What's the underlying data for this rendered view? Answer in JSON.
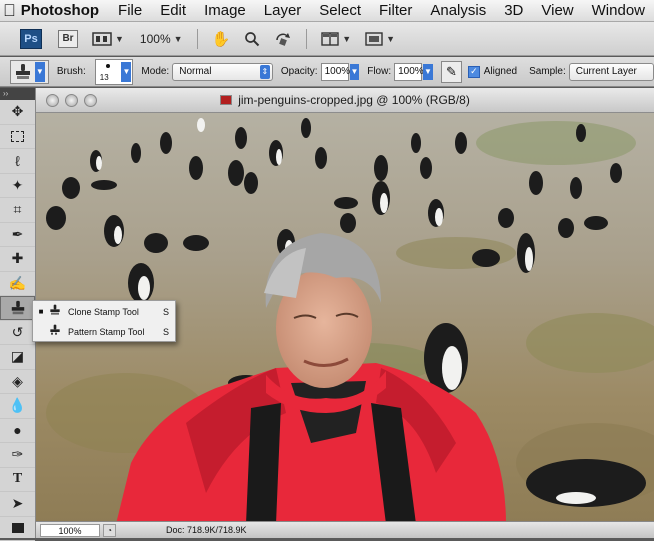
{
  "menubar": {
    "apple_icon": "apple-logo-icon",
    "app": "Photoshop",
    "items": [
      "File",
      "Edit",
      "Image",
      "Layer",
      "Select",
      "Filter",
      "Analysis",
      "3D",
      "View",
      "Window"
    ]
  },
  "appbar": {
    "ps_label": "Ps",
    "br_label": "Br",
    "zoom": "100%"
  },
  "options": {
    "brush_label": "Brush:",
    "brush_size": "13",
    "mode_label": "Mode:",
    "mode_value": "Normal",
    "opacity_label": "Opacity:",
    "opacity_value": "100%",
    "flow_label": "Flow:",
    "flow_value": "100%",
    "aligned_label": "Aligned",
    "aligned_checked": true,
    "sample_label": "Sample:",
    "sample_value": "Current Layer"
  },
  "toolbox": {
    "header": "››",
    "tools": [
      "move-tool-icon",
      "marquee-tool-icon",
      "lasso-tool-icon",
      "magic-wand-tool-icon",
      "crop-tool-icon",
      "eyedropper-tool-icon",
      "healing-brush-tool-icon",
      "brush-tool-icon",
      "clone-stamp-tool-icon",
      "history-brush-tool-icon",
      "eraser-tool-icon",
      "paint-bucket-tool-icon",
      "blur-tool-icon",
      "dodge-tool-icon",
      "pen-tool-icon",
      "type-tool-icon",
      "path-selection-tool-icon",
      "shape-tool-icon"
    ]
  },
  "document": {
    "title": "jim-penguins-cropped.jpg @ 100% (RGB/8)"
  },
  "flyout": {
    "items": [
      {
        "label": "Clone Stamp Tool",
        "shortcut": "S",
        "selected": true
      },
      {
        "label": "Pattern Stamp Tool",
        "shortcut": "S",
        "selected": false
      }
    ]
  },
  "status": {
    "zoom": "100%",
    "doc_size": "Doc: 718.9K/718.9K"
  }
}
